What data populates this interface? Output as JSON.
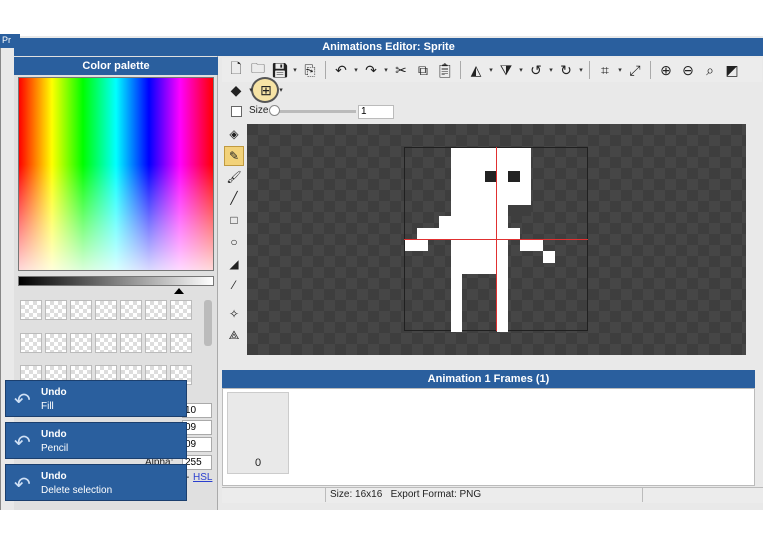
{
  "window": {
    "title": "Animations Editor: Sprite",
    "bg_title": "Pr"
  },
  "palette": {
    "title": "Color palette",
    "values": [
      "10",
      "09",
      "09",
      "255"
    ],
    "alpha_label": "Alpha:",
    "hsl_prefix": "-",
    "hsl_link": "HSL"
  },
  "toolbar": {
    "icons": [
      "new-file-icon",
      "open-folder-icon",
      "save-icon",
      "export-icon",
      "undo-icon",
      "redo-icon",
      "cut-icon",
      "copy-icon",
      "paste-icon",
      "flip-horizontal-icon",
      "flip-vertical-icon",
      "rotate-left-icon",
      "rotate-right-icon",
      "crop-icon",
      "resize-icon",
      "zoom-in-icon",
      "zoom-out-icon",
      "zoom-fit-icon",
      "toggle-grid-icon"
    ],
    "row2_icons": [
      "layers-icon",
      "snap-grid-icon"
    ]
  },
  "size": {
    "label": "Size",
    "value": "1"
  },
  "tools": [
    "eraser-icon",
    "pencil-icon",
    "brush-icon",
    "line-icon",
    "rectangle-icon",
    "ellipse-icon",
    "fill-bucket-icon",
    "eyedropper-icon",
    "select-icon",
    "nodes-icon"
  ],
  "frames": {
    "title": "Animation 1 Frames (1)",
    "frame_number": "0"
  },
  "status": {
    "text": "Size: 16x16   Export Format: PNG"
  },
  "toasts": [
    {
      "title": "Undo",
      "subtitle": "Fill"
    },
    {
      "title": "Undo",
      "subtitle": "Pencil"
    },
    {
      "title": "Undo",
      "subtitle": "Delete selection"
    }
  ],
  "colors": {
    "accent": "#2a5f9e",
    "canvas": "#3e3e3e",
    "guide": "#e03030",
    "active_tool": "#f2d27a"
  }
}
